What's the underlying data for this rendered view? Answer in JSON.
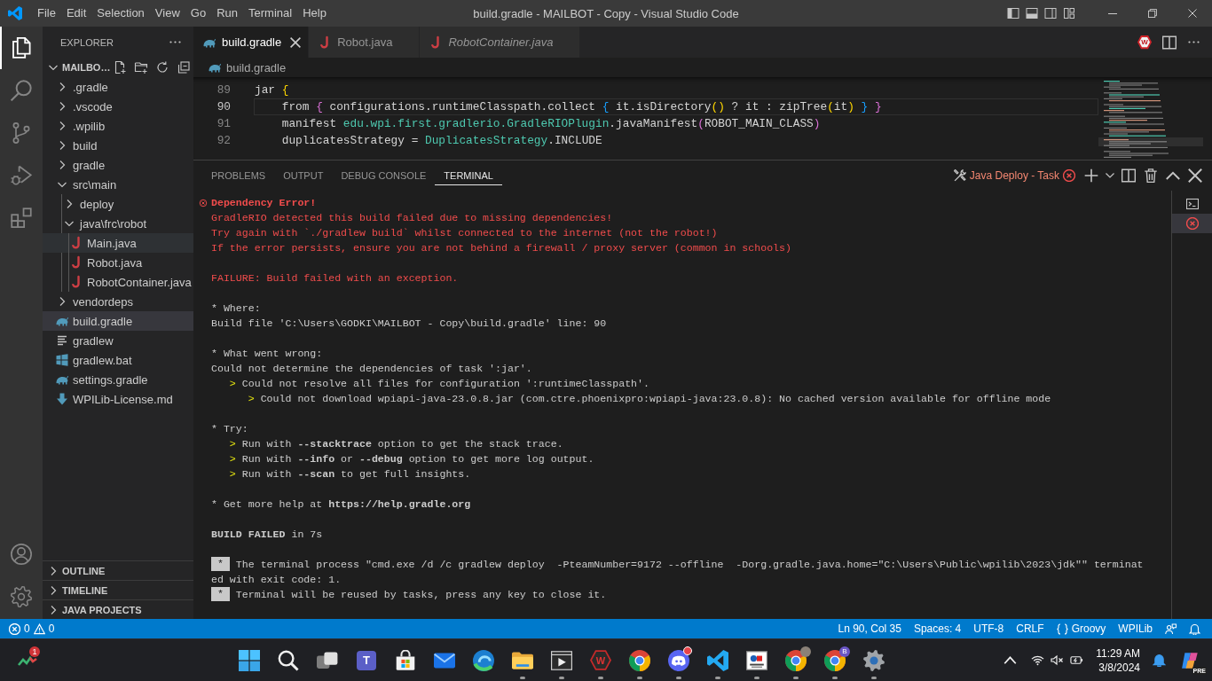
{
  "title_bar": {
    "menu": [
      "File",
      "Edit",
      "Selection",
      "View",
      "Go",
      "Run",
      "Terminal",
      "Help"
    ],
    "title": "build.gradle - MAILBOT - Copy - Visual Studio Code"
  },
  "activity_bar": {
    "items": [
      {
        "kind": "explorer",
        "selected": true
      },
      {
        "kind": "search",
        "selected": false
      },
      {
        "kind": "source_control",
        "selected": false
      },
      {
        "kind": "run_debug",
        "selected": false
      },
      {
        "kind": "extensions",
        "selected": false
      }
    ],
    "bottom": [
      {
        "kind": "account"
      },
      {
        "kind": "settings"
      }
    ]
  },
  "sidebar": {
    "title": "EXPLORER",
    "folder": {
      "label": "MAILBO…",
      "expanded": true
    },
    "tree": [
      {
        "name": ".gradle",
        "kind": "folder",
        "expanded": false,
        "selected": false,
        "hovered": false
      },
      {
        "name": ".vscode",
        "kind": "folder",
        "expanded": false,
        "selected": false,
        "hovered": false
      },
      {
        "name": ".wpilib",
        "kind": "folder",
        "expanded": false,
        "selected": false,
        "hovered": false
      },
      {
        "name": "build",
        "kind": "folder",
        "expanded": false,
        "selected": false,
        "hovered": false
      },
      {
        "name": "gradle",
        "kind": "folder",
        "expanded": false,
        "selected": false,
        "hovered": false
      },
      {
        "name": "src\\main",
        "kind": "folder",
        "expanded": true,
        "selected": false,
        "hovered": false,
        "children": [
          {
            "name": "deploy",
            "kind": "folder",
            "expanded": false,
            "selected": false,
            "hovered": false
          },
          {
            "name": "java\\frc\\robot",
            "kind": "folder",
            "expanded": true,
            "selected": false,
            "hovered": false,
            "children": [
              {
                "name": "Main.java",
                "kind": "java",
                "selected": false,
                "hovered": true
              },
              {
                "name": "Robot.java",
                "kind": "java",
                "selected": false,
                "hovered": false
              },
              {
                "name": "RobotContainer.java",
                "kind": "java",
                "selected": false,
                "hovered": false
              }
            ]
          }
        ]
      },
      {
        "name": "vendordeps",
        "kind": "folder",
        "expanded": false,
        "selected": false,
        "hovered": false
      },
      {
        "name": "build.gradle",
        "kind": "gradle",
        "selected": true,
        "hovered": false
      },
      {
        "name": "gradlew",
        "kind": "shell",
        "selected": false,
        "hovered": false
      },
      {
        "name": "gradlew.bat",
        "kind": "batch",
        "selected": false,
        "hovered": false
      },
      {
        "name": "settings.gradle",
        "kind": "gradle",
        "selected": false,
        "hovered": false
      },
      {
        "name": "WPILib-License.md",
        "kind": "markdown",
        "selected": false,
        "hovered": false
      }
    ],
    "sections": [
      {
        "title": "OUTLINE",
        "expanded": false
      },
      {
        "title": "TIMELINE",
        "expanded": false
      },
      {
        "title": "JAVA PROJECTS",
        "expanded": false
      }
    ]
  },
  "editor": {
    "tabs": [
      {
        "label": "build.gradle",
        "kind": "gradle",
        "selected": true,
        "preview": false
      },
      {
        "label": "Robot.java",
        "kind": "java",
        "selected": false,
        "preview": false
      },
      {
        "label": "RobotContainer.java",
        "kind": "java",
        "selected": false,
        "preview": true
      }
    ],
    "actions": [
      {
        "kind": "wpilib",
        "label": "W"
      },
      {
        "kind": "split"
      },
      {
        "kind": "more"
      }
    ],
    "breadcrumb": {
      "label": "build.gradle",
      "kind": "gradle"
    },
    "lines": [
      {
        "number": "89",
        "current": false,
        "tokens": [
          {
            "text": "jar ",
            "kind": "plain"
          },
          {
            "text": "{",
            "kind": "bracket_gold"
          }
        ]
      },
      {
        "number": "90",
        "current": true,
        "tokens": [
          {
            "text": "    from ",
            "kind": "plain"
          },
          {
            "text": "{",
            "kind": "bracket_purple"
          },
          {
            "text": " configurations.runtimeClasspath.collect ",
            "kind": "plain"
          },
          {
            "text": "{",
            "kind": "bracket_blue"
          },
          {
            "text": " it.isDirectory",
            "kind": "plain"
          },
          {
            "text": "()",
            "kind": "bracket_gold"
          },
          {
            "text": " ? it : zipTree",
            "kind": "plain"
          },
          {
            "text": "(",
            "kind": "bracket_gold"
          },
          {
            "text": "it",
            "kind": "plain"
          },
          {
            "text": ")",
            "kind": "bracket_gold"
          },
          {
            "text": " }",
            "kind": "bracket_blue"
          },
          {
            "text": " }",
            "kind": "bracket_purple"
          }
        ]
      },
      {
        "number": "91",
        "current": false,
        "tokens": [
          {
            "text": "    manifest ",
            "kind": "plain"
          },
          {
            "text": "edu.wpi.first.gradlerio.GradleRIOPlugin",
            "kind": "type"
          },
          {
            "text": ".javaManifest",
            "kind": "plain"
          },
          {
            "text": "(",
            "kind": "bracket_purple"
          },
          {
            "text": "ROBOT_MAIN_CLASS",
            "kind": "plain"
          },
          {
            "text": ")",
            "kind": "bracket_purple"
          }
        ]
      },
      {
        "number": "92",
        "current": false,
        "tokens": [
          {
            "text": "    duplicatesStrategy = ",
            "kind": "plain"
          },
          {
            "text": "DuplicatesStrategy",
            "kind": "type"
          },
          {
            "text": ".INCLUDE",
            "kind": "plain"
          }
        ]
      }
    ]
  },
  "panel": {
    "tabs": [
      {
        "label": "PROBLEMS",
        "selected": false
      },
      {
        "label": "OUTPUT",
        "selected": false
      },
      {
        "label": "DEBUG CONSOLE",
        "selected": false
      },
      {
        "label": "TERMINAL",
        "selected": true
      }
    ],
    "task": {
      "label": "Java Deploy - Task",
      "failed": true
    },
    "terminal": {
      "blocks": [
        {
          "lines": [
            {
              "kind": "error_heading",
              "text": "Dependency Error!"
            },
            {
              "kind": "error",
              "text": "GradleRIO detected this build failed due to missing dependencies!"
            },
            {
              "kind": "error",
              "text": "Try again with `./gradlew build` whilst connected to the internet (not the robot!)"
            },
            {
              "kind": "error",
              "text": "If the error persists, ensure you are not behind a firewall / proxy server (common in schools)"
            }
          ]
        },
        {
          "lines": [
            {
              "kind": "error",
              "text": "FAILURE: Build failed with an exception."
            }
          ]
        },
        {
          "lines": [
            {
              "kind": "plain",
              "text": "* Where:"
            },
            {
              "kind": "plain",
              "text": "Build file 'C:\\Users\\GODKI\\MAILBOT - Copy\\build.gradle' line: 90"
            }
          ]
        },
        {
          "lines": [
            {
              "kind": "plain",
              "text": "* What went wrong:"
            },
            {
              "kind": "plain",
              "text": "Could not determine the dependencies of task ':jar'."
            },
            {
              "kind": "bullet",
              "marker": ">",
              "text": "Could not resolve all files for configuration ':runtimeClasspath'.",
              "children": [
                {
                  "kind": "bullet",
                  "marker": ">",
                  "text": "Could not download wpiapi-java-23.0.8.jar (com.ctre.phoenixpro:wpiapi-java:23.0.8): No cached version available for offline mode"
                }
              ]
            }
          ]
        },
        {
          "lines": [
            {
              "kind": "plain",
              "text": "* Try:"
            },
            {
              "kind": "bullet",
              "marker": ">",
              "text": "Run with **--stacktrace** option to get the stack trace."
            },
            {
              "kind": "bullet",
              "marker": ">",
              "text": "Run with **--info** or **--debug** option to get more log output."
            },
            {
              "kind": "bullet",
              "marker": ">",
              "text": "Run with **--scan** to get full insights."
            }
          ]
        },
        {
          "lines": [
            {
              "kind": "plain",
              "text": "* Get more help at **https://help.gradle.org**"
            }
          ]
        },
        {
          "lines": [
            {
              "kind": "result",
              "text": "**BUILD FAILED** in 7s"
            }
          ]
        },
        {
          "lines": [
            {
              "kind": "task",
              "marker": "*",
              "text": "The terminal process \"cmd.exe /d /c gradlew deploy  -PteamNumber=9172 --offline  -Dorg.gradle.java.home=\"C:\\Users\\Public\\wpilib\\2023\\jdk\"\" terminat"
            },
            {
              "kind": "plain",
              "text": "ed with exit code: 1."
            },
            {
              "kind": "task",
              "marker": "*",
              "text": "Terminal will be reused by tasks, press any key to close it."
            }
          ]
        }
      ]
    },
    "terminal_list": [
      {
        "kind": "shell",
        "failed": false,
        "selected": false
      },
      {
        "kind": "task",
        "failed": true,
        "selected": true
      }
    ]
  },
  "status_bar": {
    "problems": {
      "errors": "0",
      "warnings": "0"
    },
    "items": [
      {
        "kind": "text",
        "label": "Ln 90, Col 35"
      },
      {
        "kind": "text",
        "label": "Spaces: 4"
      },
      {
        "kind": "text",
        "label": "UTF-8"
      },
      {
        "kind": "text",
        "label": "CRLF"
      },
      {
        "kind": "language",
        "label": "Groovy"
      },
      {
        "kind": "text",
        "label": "WPILib"
      },
      {
        "kind": "feedback"
      },
      {
        "kind": "notifications"
      }
    ]
  },
  "taskbar": {
    "widget": {
      "badge": "1"
    },
    "apps": [
      {
        "kind": "start",
        "running": false,
        "notification": false
      },
      {
        "kind": "search",
        "running": false,
        "notification": false
      },
      {
        "kind": "task_view",
        "running": false,
        "notification": false
      },
      {
        "kind": "teams",
        "label": "T",
        "running": false,
        "notification": false
      },
      {
        "kind": "store",
        "running": false,
        "notification": false
      },
      {
        "kind": "mail",
        "running": false,
        "notification": false
      },
      {
        "kind": "edge",
        "running": false,
        "notification": false
      },
      {
        "kind": "file_explorer",
        "running": true,
        "notification": false
      },
      {
        "kind": "media_app",
        "running": true,
        "notification": false
      },
      {
        "kind": "hex_app",
        "label": "W",
        "running": true,
        "notification": false
      },
      {
        "kind": "chrome",
        "running": true,
        "notification": false
      },
      {
        "kind": "discord",
        "running": true,
        "notification": true
      },
      {
        "kind": "vscode",
        "running": true,
        "notification": false
      },
      {
        "kind": "first_app",
        "running": true,
        "notification": false
      },
      {
        "kind": "chrome",
        "running": true,
        "notification": false,
        "avatar": {
          "kind": "photo"
        }
      },
      {
        "kind": "chrome",
        "running": true,
        "notification": false,
        "avatar": {
          "kind": "letter",
          "text": "B"
        }
      },
      {
        "kind": "gear_app",
        "running": true,
        "notification": false
      }
    ],
    "tray": {
      "time": "11:29 AM",
      "date": "3/8/2024",
      "copilot_badge": "PRE"
    }
  }
}
